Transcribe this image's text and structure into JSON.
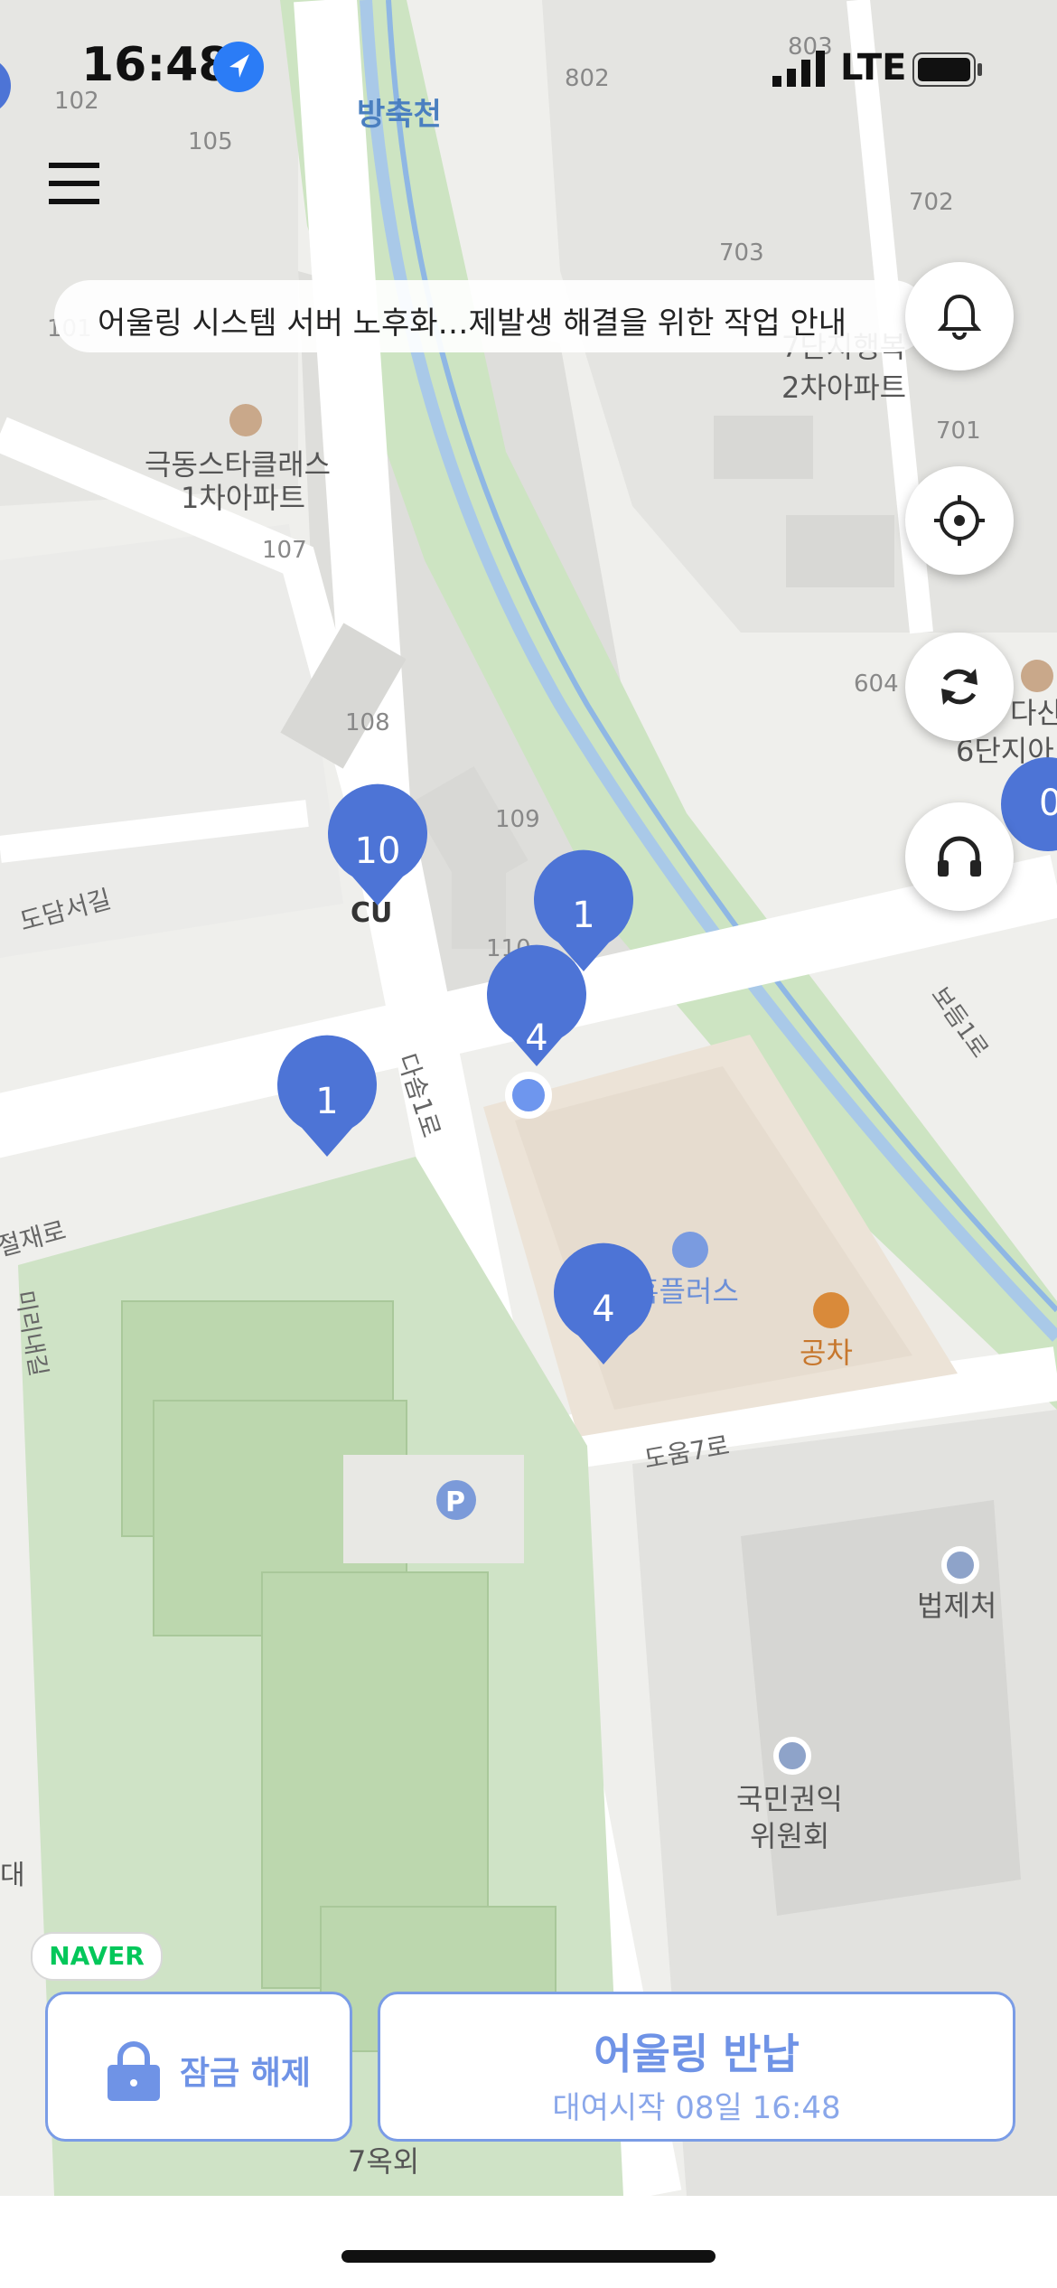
{
  "status_bar": {
    "time": "16:48",
    "network": "LTE"
  },
  "notice": {
    "text": "어울링 시스템 서버 노후화…제발생 해결을 위한 작업 안내"
  },
  "map": {
    "labels": {
      "stream": "방축천",
      "apt_a": "극동스타클래스",
      "apt_a2": "1차아파트",
      "apt_b": "7단지행복",
      "apt_b2": "2차아파트",
      "apt_c": "다산",
      "apt_c2": "6단지아",
      "road_1": "도담서길",
      "road_2": "다솜1로",
      "road_3": "절재로",
      "road_4": "미리내길",
      "road_5": "도움7로",
      "road_6": "보듬1로",
      "mart": "홈플러스",
      "cafe": "공차",
      "cu": "CU",
      "gov_1": "법제처",
      "gov_2": "국민권익",
      "gov_2b": "위원회",
      "bottom_stop": "7옥외",
      "b102": "102",
      "b105": "105",
      "b802": "802",
      "b803": "803",
      "b702": "702",
      "b703": "703",
      "b701": "701",
      "b107": "107",
      "b604": "604",
      "b108": "108",
      "b109": "109",
      "b110": "110",
      "b101": "101",
      "parking": "P",
      "left_edge": "대",
      "partial_pin": "0"
    },
    "pins": [
      {
        "name": "station-pin-cu",
        "count": "10"
      },
      {
        "name": "station-pin-110",
        "count": "1"
      },
      {
        "name": "station-pin-crossing",
        "count": "4"
      },
      {
        "name": "station-pin-west",
        "count": "1"
      },
      {
        "name": "station-pin-homeplus",
        "count": "4"
      }
    ]
  },
  "branding": {
    "naver": "NAVER"
  },
  "buttons": {
    "unlock": "잠금 해제",
    "return_title": "어울링 반납",
    "return_sub": "대여시작 08일 16:48"
  },
  "colors": {
    "accent": "#4d74d6",
    "button_border": "#7a9ce6",
    "park": "#cfe3c6",
    "road": "#ffffff",
    "block": "#e4e4e2"
  },
  "icons": [
    "location-arrow-icon",
    "menu-icon",
    "bell-icon",
    "crosshair-icon",
    "refresh-icon",
    "headset-icon",
    "lock-icon"
  ]
}
